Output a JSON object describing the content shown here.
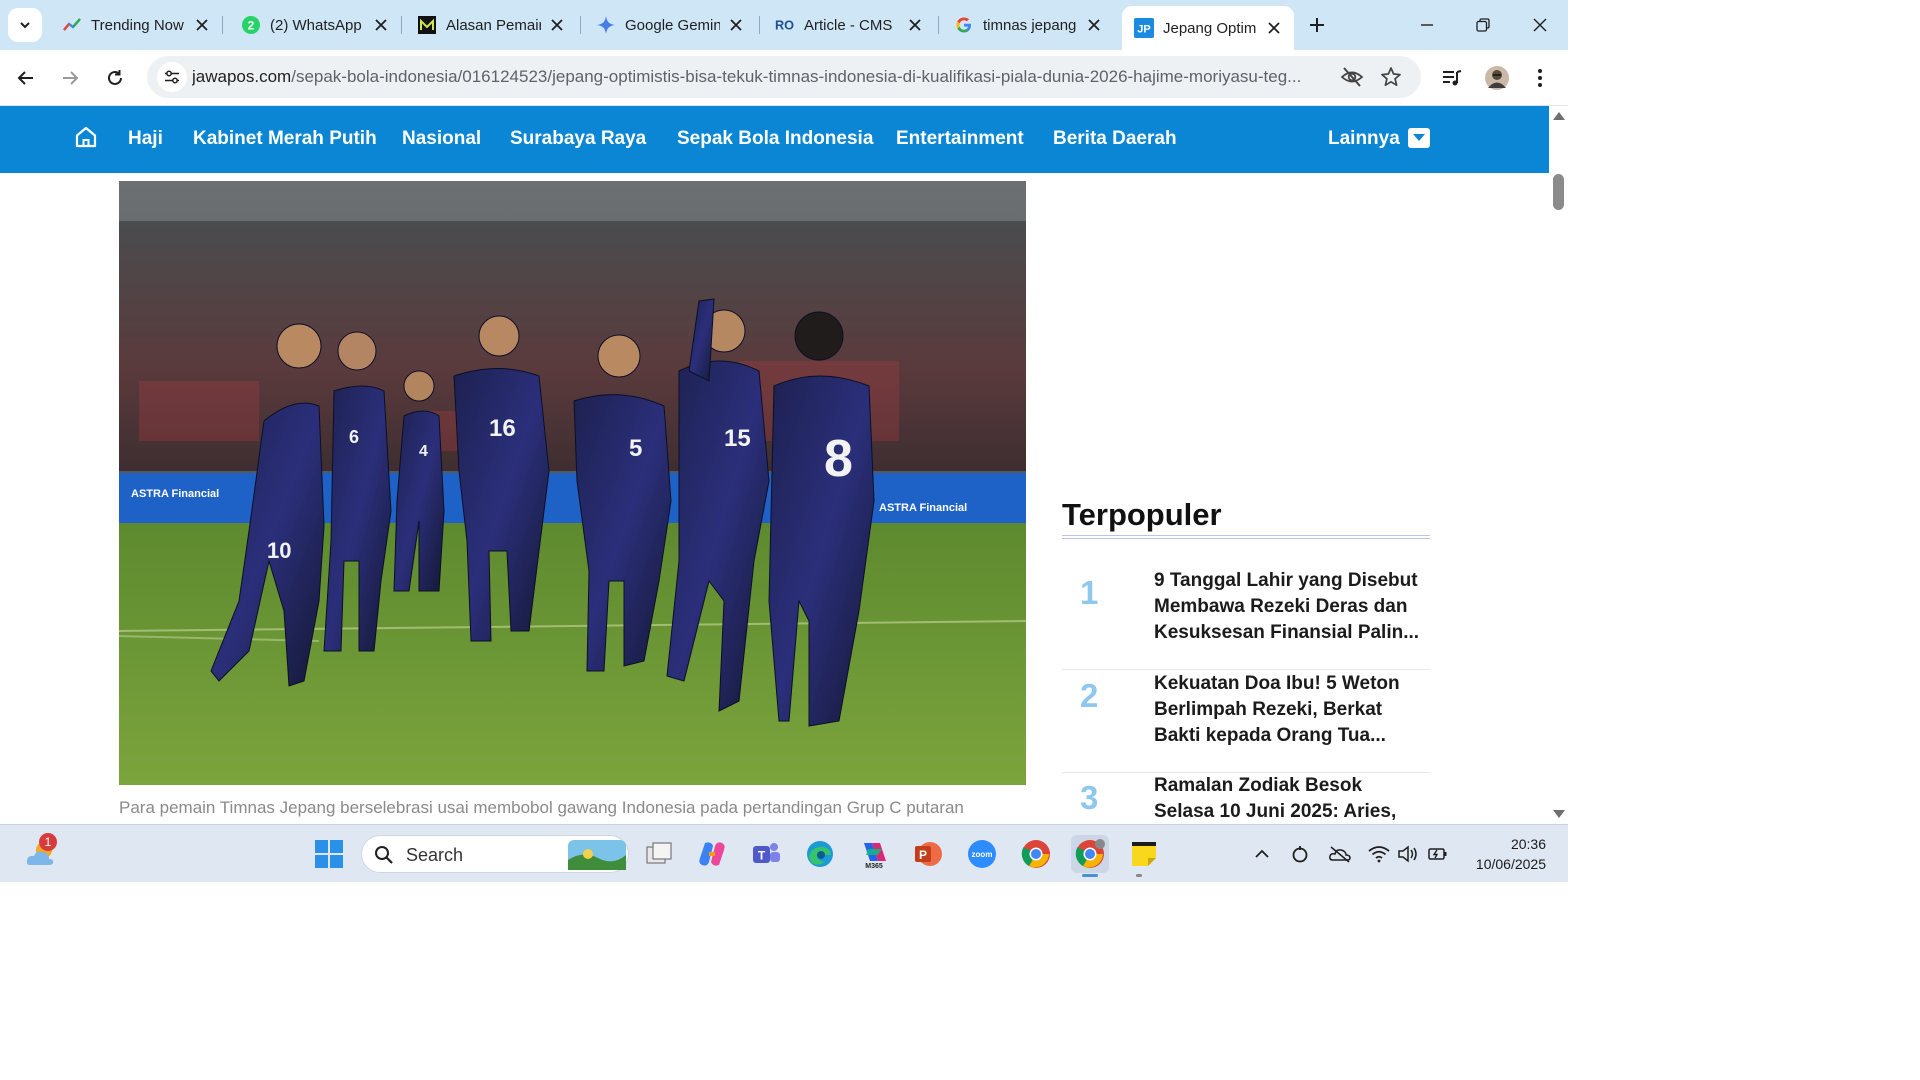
{
  "browser": {
    "tabs": [
      {
        "title": "Trending Now",
        "favicon": "trending-icon",
        "active": false
      },
      {
        "title": "(2) WhatsApp",
        "favicon": "whatsapp-icon",
        "active": false
      },
      {
        "title": "Alasan Pemair",
        "favicon": "m-logo-icon",
        "active": false
      },
      {
        "title": "Google Gemin",
        "favicon": "gemini-sparkle-icon",
        "active": false
      },
      {
        "title": "Article - CMS",
        "favicon": "ro-logo-icon",
        "active": false
      },
      {
        "title": "timnas jepang",
        "favicon": "google-g-icon",
        "active": false
      },
      {
        "title": "Jepang Optim",
        "favicon": "jp-logo-icon",
        "active": true
      }
    ],
    "url_host": "jawapos.com",
    "url_path": "/sepak-bola-indonesia/016124523/jepang-optimistis-bisa-tekuk-timnas-indonesia-di-kualifikasi-piala-dunia-2026-hajime-moriyasu-teg..."
  },
  "site_nav": {
    "items": [
      "Haji",
      "Kabinet Merah Putih",
      "Nasional",
      "Surabaya Raya",
      "Sepak Bola Indonesia",
      "Entertainment",
      "Berita Daerah"
    ],
    "more_label": "Lainnya"
  },
  "article": {
    "caption": "Para pemain Timnas Jepang berselebrasi usai membobol gawang Indonesia pada pertandingan Grup C putaran",
    "photo": {
      "board_text": "ASTRA Financial",
      "jersey_numbers": [
        "10",
        "6",
        "4",
        "16",
        "5",
        "15",
        "8"
      ]
    }
  },
  "sidebar": {
    "title": "Terpopuler",
    "items": [
      {
        "rank": "1",
        "title": "9 Tanggal Lahir yang Disebut Membawa Rezeki Deras dan Kesuksesan Finansial Palin..."
      },
      {
        "rank": "2",
        "title": "Kekuatan Doa Ibu! 5 Weton Berlimpah Rezeki, Berkat Bakti kepada Orang Tua..."
      },
      {
        "rank": "3",
        "title": "Ramalan Zodiak Besok Selasa 10 Juni 2025: Aries,"
      }
    ]
  },
  "taskbar": {
    "weather_badge": "1",
    "search_label": "Search",
    "time": "20:36",
    "date": "10/06/2025"
  },
  "colors": {
    "nav_blue": "#0a86d4",
    "tab_strip": "#cfe6f7",
    "rank_blue": "#8ec8ef"
  }
}
